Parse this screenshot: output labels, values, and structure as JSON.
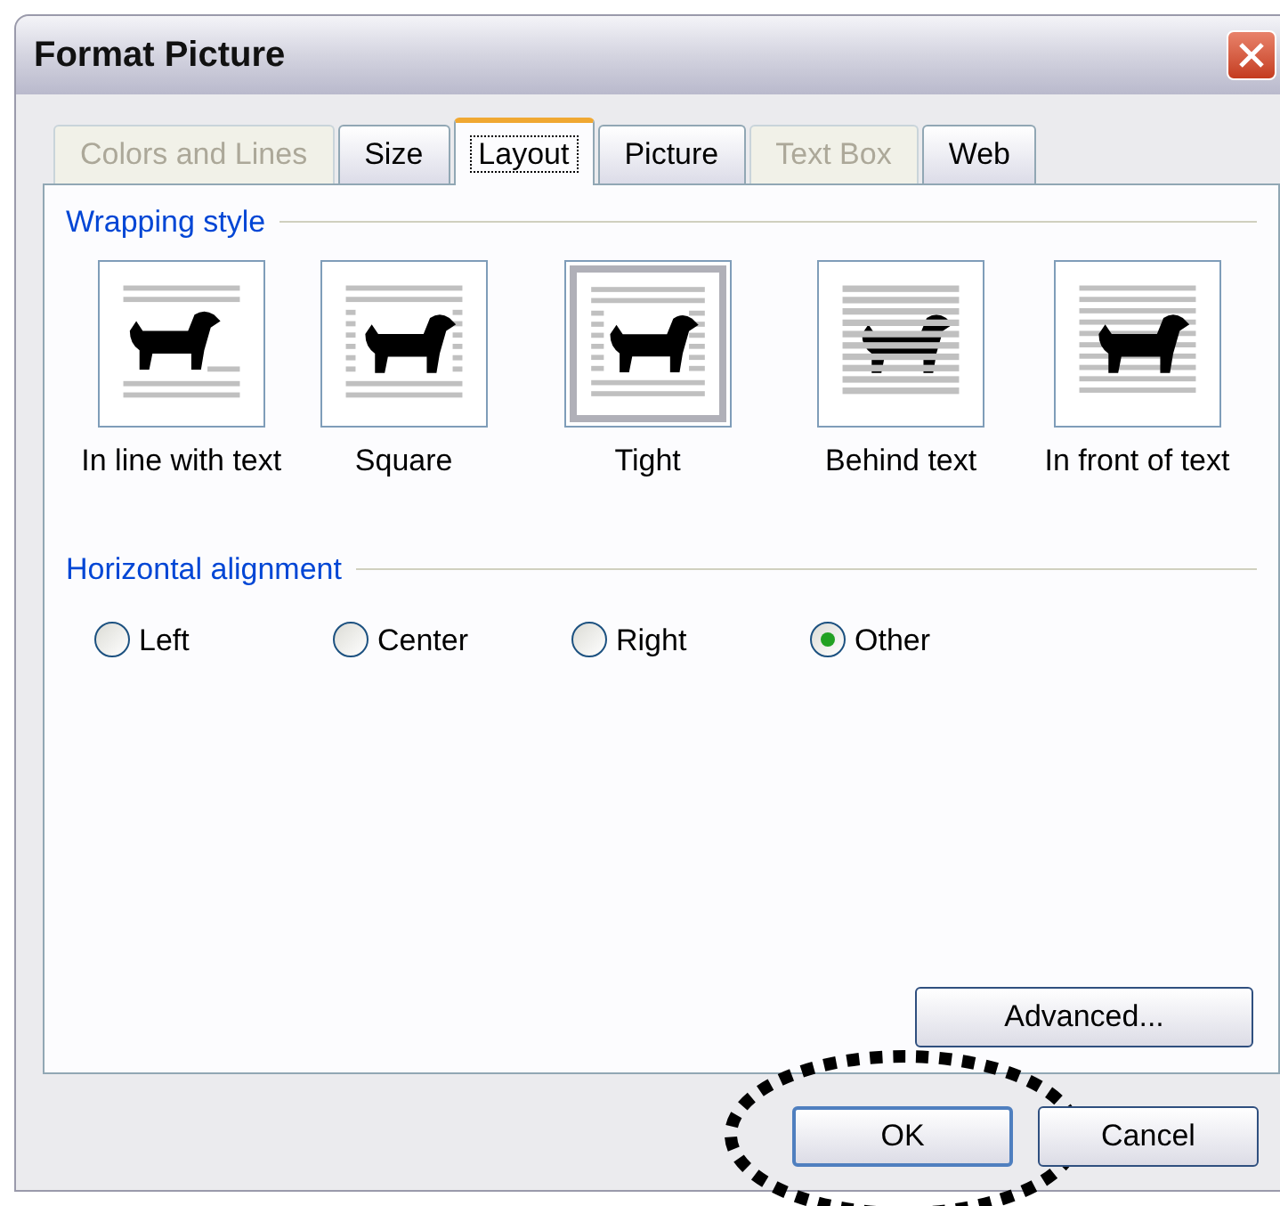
{
  "window": {
    "title": "Format Picture"
  },
  "tabs": [
    {
      "label": "Colors and Lines",
      "selected": false,
      "disabled": true
    },
    {
      "label": "Size",
      "selected": false,
      "disabled": false
    },
    {
      "label": "Layout",
      "selected": true,
      "disabled": false
    },
    {
      "label": "Picture",
      "selected": false,
      "disabled": false
    },
    {
      "label": "Text Box",
      "selected": false,
      "disabled": true
    },
    {
      "label": "Web",
      "selected": false,
      "disabled": false
    }
  ],
  "wrapping_style": {
    "heading": "Wrapping style",
    "options": [
      {
        "label": "In line with text",
        "kind": "inline",
        "selected": false
      },
      {
        "label": "Square",
        "kind": "square",
        "selected": false
      },
      {
        "label": "Tight",
        "kind": "tight",
        "selected": true
      },
      {
        "label": "Behind text",
        "kind": "behind",
        "selected": false
      },
      {
        "label": "In front of text",
        "kind": "front",
        "selected": false
      }
    ]
  },
  "horizontal_alignment": {
    "heading": "Horizontal alignment",
    "options": [
      {
        "label": "Left",
        "selected": false
      },
      {
        "label": "Center",
        "selected": false
      },
      {
        "label": "Right",
        "selected": false
      },
      {
        "label": "Other",
        "selected": true
      }
    ]
  },
  "advanced_button": "Advanced...",
  "buttons": [
    {
      "label": "OK",
      "circled": true
    },
    {
      "label": "Cancel",
      "circled": false
    }
  ]
}
